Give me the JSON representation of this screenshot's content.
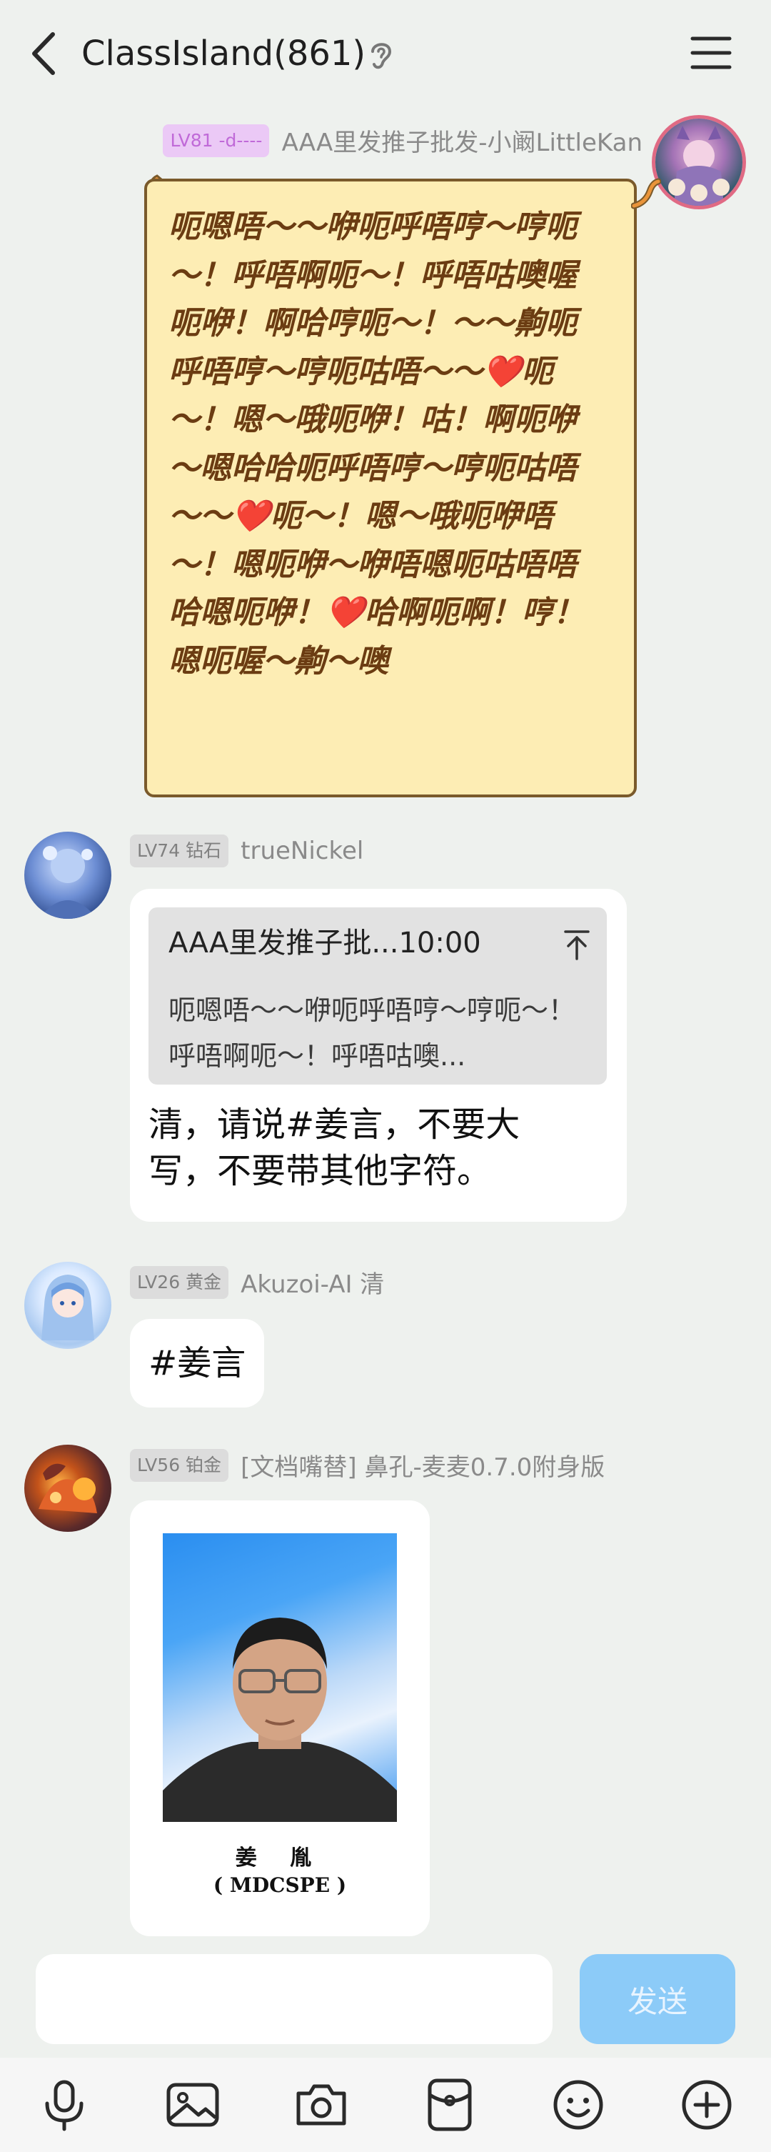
{
  "header": {
    "title": "ClassIsland(861)",
    "icons": [
      "back-arrow-icon",
      "ear-icon",
      "menu-icon"
    ]
  },
  "messages": [
    {
      "level": "LV81 -d----",
      "sender": "AAA里发推子批发-小阚LittleKan",
      "text": "呃嗯唔～～咿呃呼唔哼～哼呃～！呼唔啊呃～！呼唔咕噢喔呃咿！啊哈哼呃～！～～齁呃呼唔哼～哼呃咕唔～～❤️呃～！嗯～哦呃咿！咕！啊呃咿～嗯哈哈呃呼唔哼～哼呃咕唔～～❤️呃～！嗯～哦呃咿唔～！嗯呃咿～咿唔嗯呃咕唔唔哈嗯呃咿！❤️哈啊呃啊！哼！嗯呃喔～齁～噢"
    },
    {
      "level": "LV74 钻石",
      "sender": "trueNickel",
      "quote_sender": "AAA里发推子批...10:00",
      "quote_text": "呃嗯唔～～咿呃呼唔哼～哼呃～！呼唔啊呃～！呼唔咕噢...",
      "text": "清，请说#姜言，不要大写，不要带其他字符。"
    },
    {
      "level": "LV26 黄金",
      "sender": "Akuzoi-AI 清",
      "text": "#姜言"
    },
    {
      "level": "LV56 铂金",
      "sender": "[文档嘴替] 鼻孔-麦麦0.7.0附身版",
      "caption_name": "姜 胤",
      "caption_sub": "( MDCSPE )"
    }
  ],
  "input": {
    "placeholder": "",
    "send_label": "发送"
  },
  "toolbar": {
    "icons": [
      "microphone-icon",
      "image-icon",
      "camera-icon",
      "red-packet-icon",
      "emoji-icon",
      "plus-icon"
    ]
  },
  "colors": {
    "background": "#eef1ee",
    "send_button": "#8ccbf8",
    "paper_bubble": "#fdedb4",
    "paper_text": "#6b3c12"
  }
}
